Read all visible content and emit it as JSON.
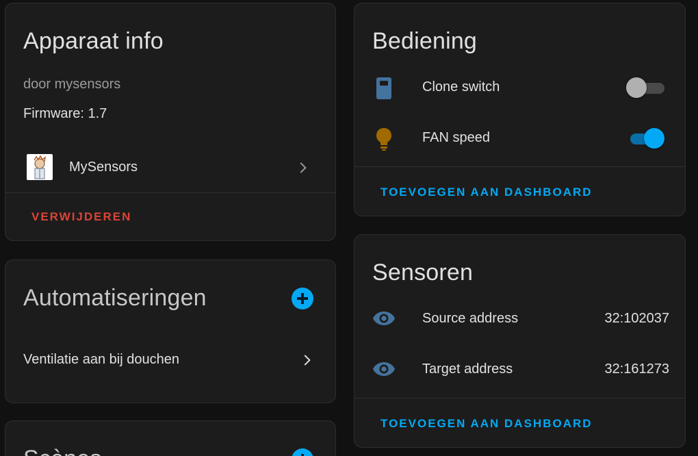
{
  "device_info": {
    "title": "Apparaat info",
    "manufacturer": "door mysensors",
    "firmware": "Firmware: 1.7",
    "integration": "MySensors",
    "delete_label": "VERWIJDEREN"
  },
  "automations": {
    "title": "Automatiseringen",
    "items": [
      {
        "label": "Ventilatie aan bij douchen"
      }
    ]
  },
  "scenes": {
    "title": "Scènes"
  },
  "controls": {
    "title": "Bediening",
    "items": [
      {
        "label": "Clone switch",
        "icon": "remote-icon",
        "state": "off"
      },
      {
        "label": "FAN speed",
        "icon": "lightbulb-icon",
        "state": "on"
      }
    ],
    "add_label": "TOEVOEGEN AAN DASHBOARD"
  },
  "sensors": {
    "title": "Sensoren",
    "items": [
      {
        "label": "Source address",
        "value": "32:102037",
        "icon": "eye-icon"
      },
      {
        "label": "Target address",
        "value": "32:161273",
        "icon": "eye-icon"
      }
    ],
    "add_label": "TOEVOEGEN AAN DASHBOARD"
  },
  "colors": {
    "background": "#111111",
    "card": "#1c1c1c",
    "accent": "#03a9f4",
    "danger": "#db4437",
    "icon_blue": "#44739e",
    "icon_amber": "#a06a00"
  }
}
